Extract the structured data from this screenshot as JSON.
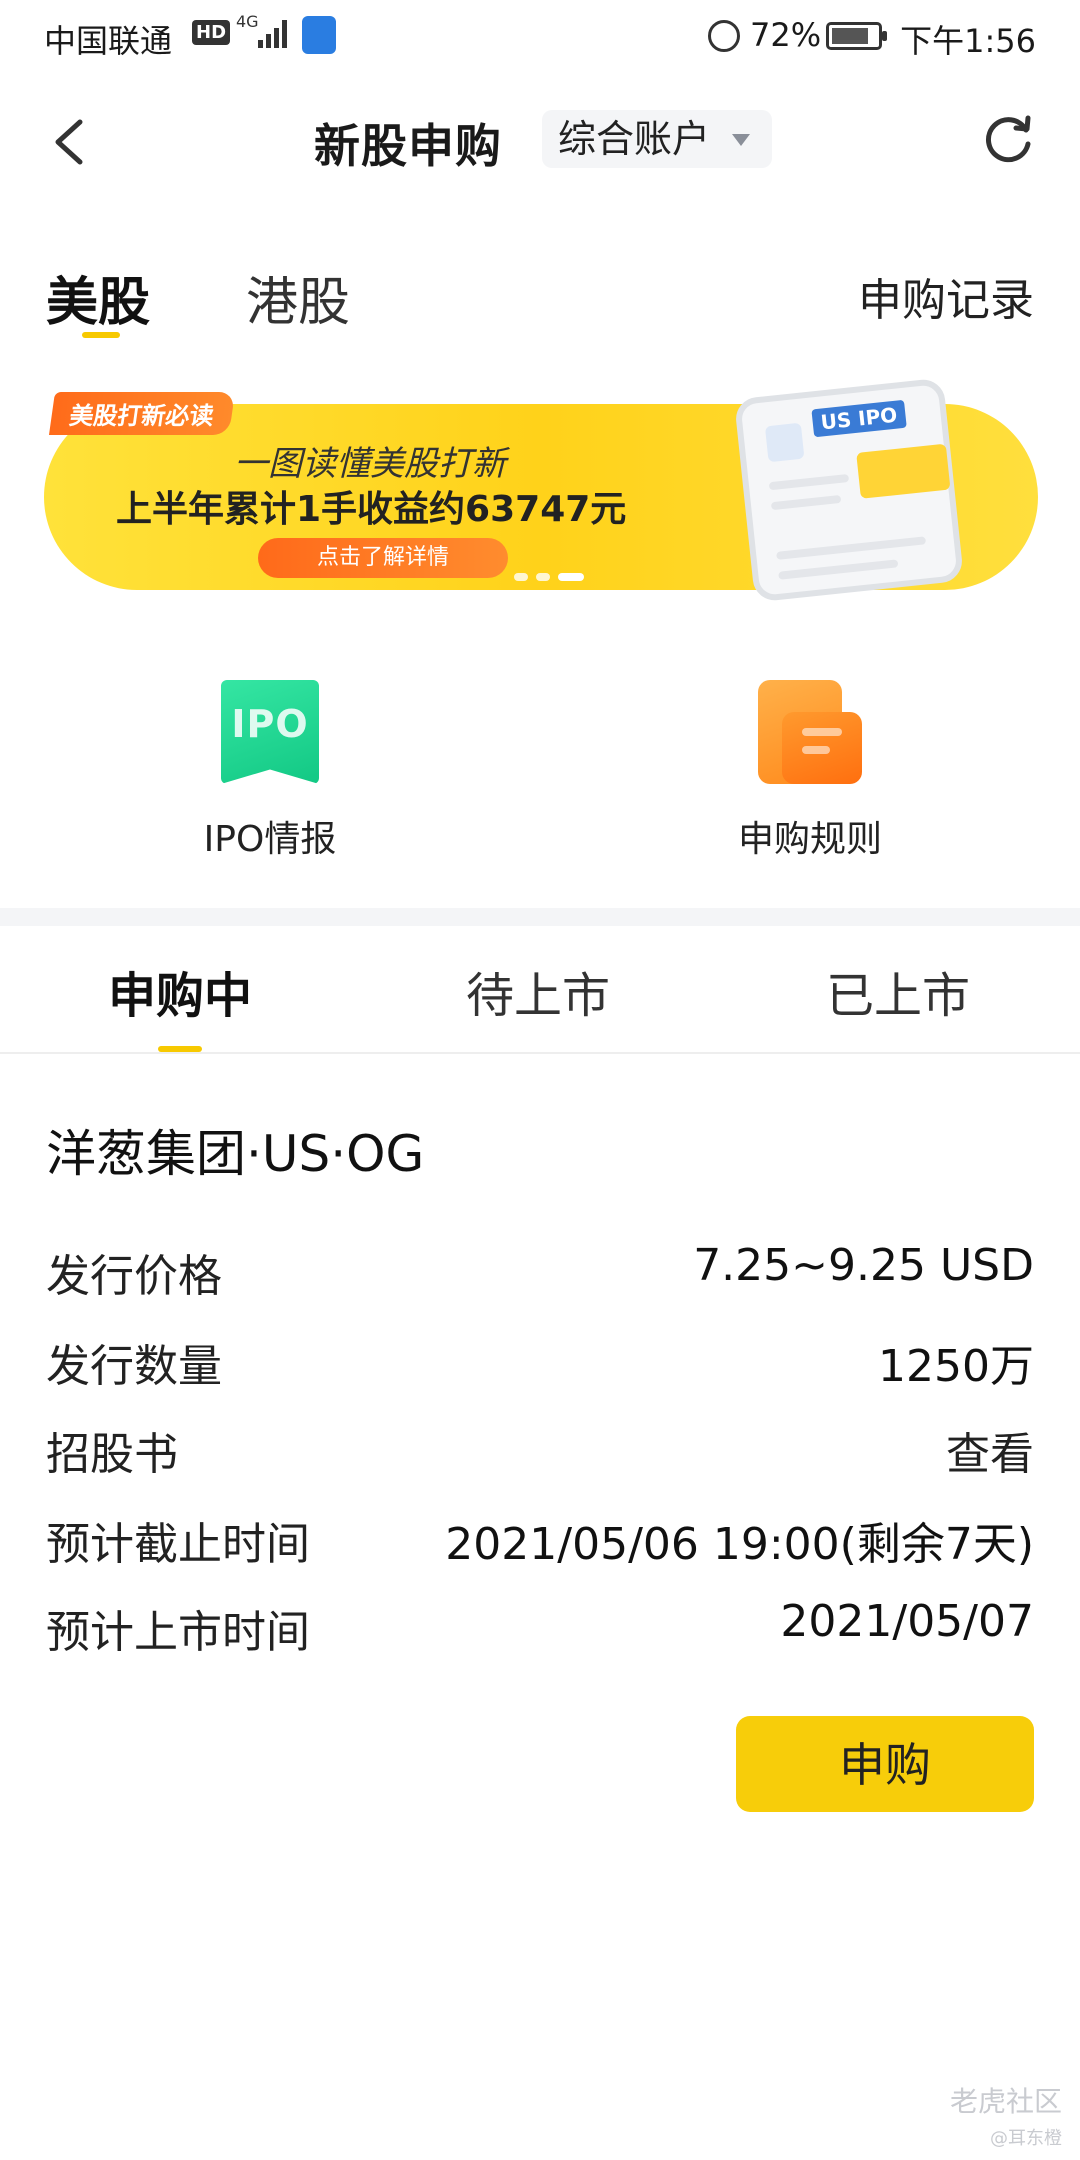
{
  "status_bar": {
    "carrier": "中国联通",
    "hd": "HD",
    "network": "4G",
    "battery": "72%",
    "time": "下午1:56"
  },
  "nav": {
    "title": "新股申购",
    "account": "综合账户"
  },
  "market_tabs": {
    "items": [
      "美股",
      "港股"
    ],
    "active": "美股",
    "records_link": "申购记录"
  },
  "banner": {
    "badge": "美股打新必读",
    "subtitle": "一图读懂美股打新",
    "headline": "上半年累计1手收益约63747元",
    "button": "点击了解详情",
    "phone_tag": "US IPO"
  },
  "quick_entries": [
    {
      "label": "IPO情报",
      "icon": "IPO"
    },
    {
      "label": "申购规则"
    }
  ],
  "status_tabs": {
    "items": [
      "申购中",
      "待上市",
      "已上市"
    ],
    "active": "申购中"
  },
  "ipo": {
    "name": "洋葱集团·US·OG",
    "fields": [
      {
        "label": "发行价格",
        "value": "7.25~9.25 USD"
      },
      {
        "label": "发行数量",
        "value": "1250万"
      },
      {
        "label": "招股书",
        "value": "查看"
      },
      {
        "label": "预计截止时间",
        "value": "2021/05/06 19:00(剩余7天)"
      },
      {
        "label": "预计上市时间",
        "value": "2021/05/07"
      }
    ],
    "button": "申购"
  },
  "watermark": {
    "main": "老虎社区",
    "sub": "@耳东橙"
  },
  "colors": {
    "accent_yellow": "#f7cd0a",
    "ipo_green": "#12c884",
    "rules_orange": "#ff8a1c"
  }
}
